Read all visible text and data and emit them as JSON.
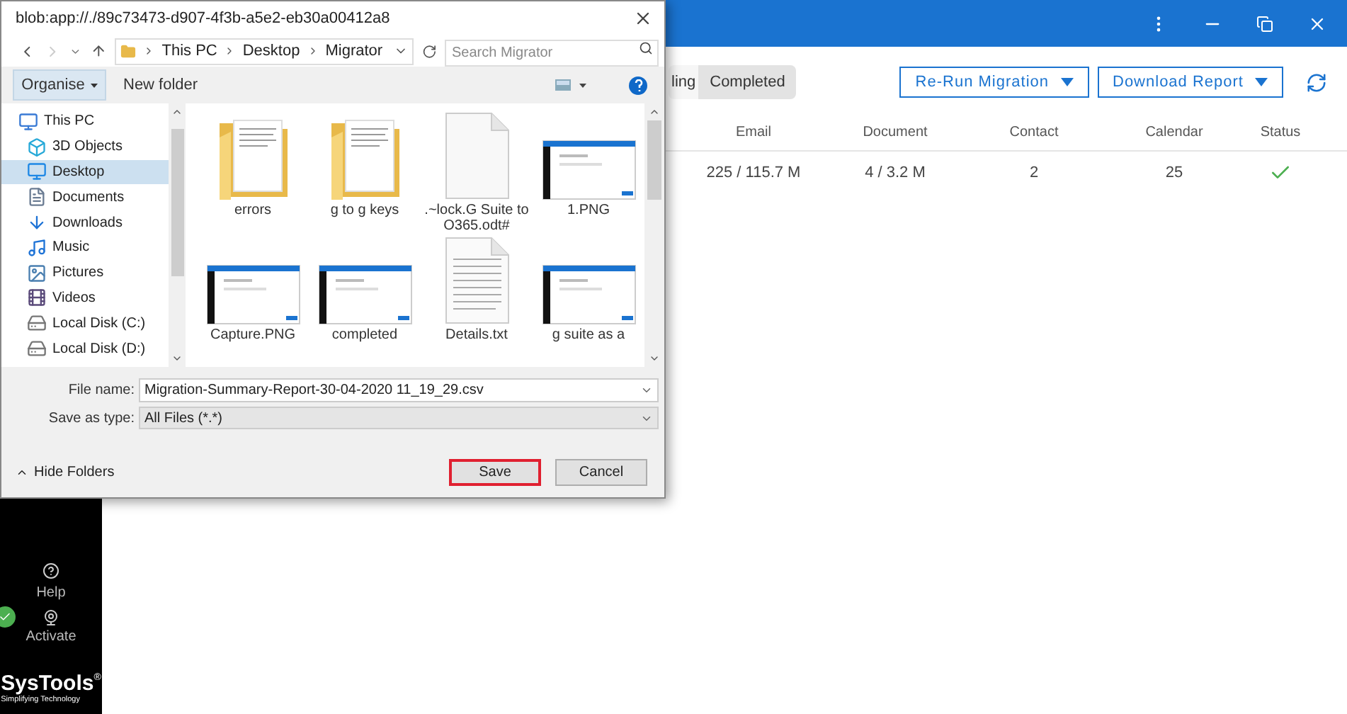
{
  "app": {
    "tabs": [
      {
        "label": "ling",
        "selected": false
      },
      {
        "label": "Completed",
        "selected": true
      }
    ],
    "actions": [
      "Re-Run Migration",
      "Download Report"
    ],
    "table": {
      "columns": [
        "Email",
        "Document",
        "Contact",
        "Calendar",
        "Status"
      ],
      "rows": [
        {
          "cells": [
            "225 / 115.7 M",
            "4 / 3.2 M",
            "2",
            "25"
          ],
          "done": true
        }
      ]
    },
    "sidebar": {
      "help": "Help",
      "activate": "Activate",
      "activated": true,
      "logo": "SysTools",
      "logo_mark": "®",
      "tagline": "Simplifying Technology"
    }
  },
  "dialog": {
    "title": "blob:app://./89c73473-d907-4f3b-a5e2-eb30a00412a8",
    "breadcrumbs": [
      "This PC",
      "Desktop",
      "Migrator"
    ],
    "search": {
      "placeholder": "Search Migrator"
    },
    "toolbar": [
      "Organise",
      "New folder"
    ],
    "tree": [
      {
        "label": "This PC",
        "kind": "pc",
        "selected": false,
        "children": [
          {
            "label": "3D Objects",
            "kind": "cube",
            "selected": false
          },
          {
            "label": "Desktop",
            "kind": "desktop",
            "selected": true
          },
          {
            "label": "Documents",
            "kind": "documents",
            "selected": false
          },
          {
            "label": "Downloads",
            "kind": "downloads",
            "selected": false
          },
          {
            "label": "Music",
            "kind": "music",
            "selected": false
          },
          {
            "label": "Pictures",
            "kind": "pictures",
            "selected": false
          },
          {
            "label": "Videos",
            "kind": "videos",
            "selected": false
          },
          {
            "label": "Local Disk (C:)",
            "kind": "disk",
            "selected": false
          },
          {
            "label": "Local Disk (D:)",
            "kind": "disk",
            "selected": false
          }
        ]
      }
    ],
    "files": [
      {
        "name": "errors",
        "kind": "folder"
      },
      {
        "name": "g to g keys",
        "kind": "folder"
      },
      {
        "name": ".~lock.G Suite to O365.odt#",
        "kind": "file"
      },
      {
        "name": "1.PNG",
        "kind": "image"
      },
      {
        "name": "Capture.PNG",
        "kind": "image"
      },
      {
        "name": "completed",
        "kind": "image"
      },
      {
        "name": "Details.txt",
        "kind": "text"
      },
      {
        "name": "g suite as a",
        "kind": "image"
      }
    ],
    "file_name": {
      "label": "File name:",
      "value": "Migration-Summary-Report-30-04-2020 11_19_29.csv"
    },
    "save_type": {
      "label": "Save as type:",
      "value": "All Files (*.*)"
    },
    "hide_folders": "Hide Folders",
    "buttons": [
      {
        "label": "Save",
        "focused": true
      },
      {
        "label": "Cancel",
        "focused": false
      }
    ]
  }
}
